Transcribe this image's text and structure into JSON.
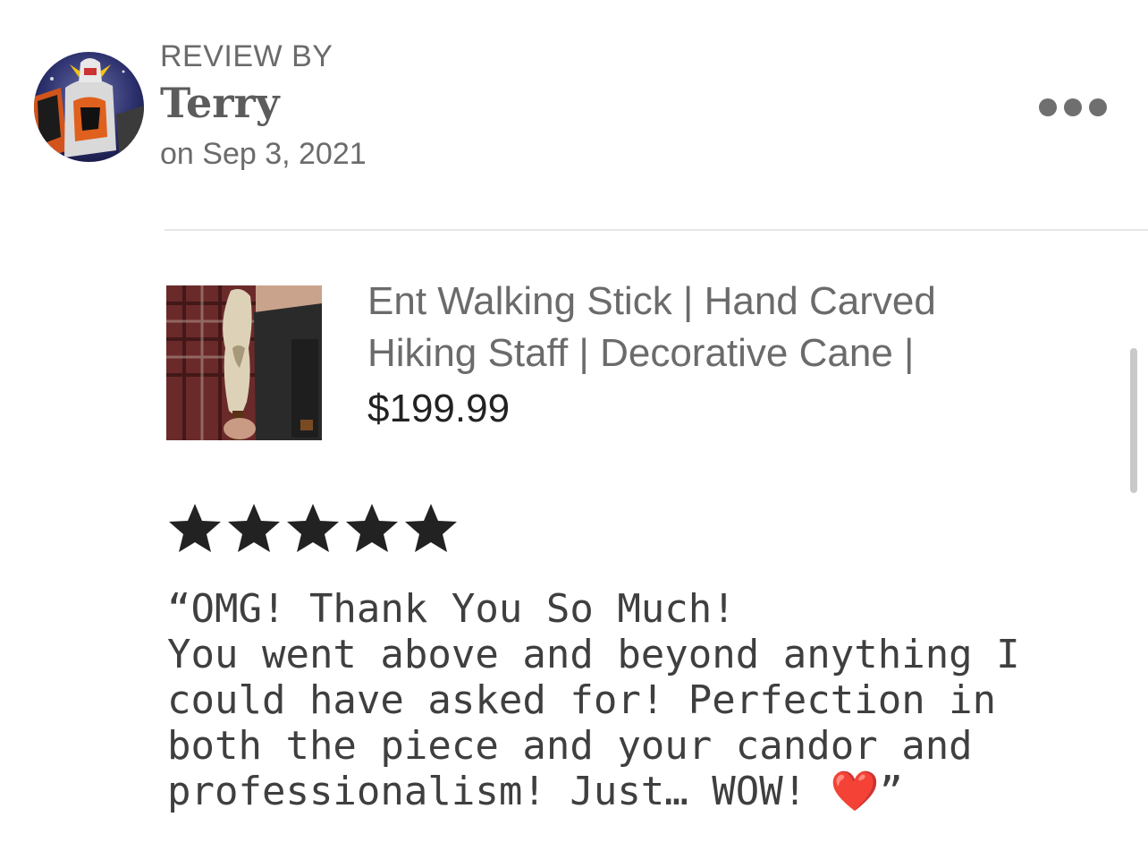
{
  "header": {
    "review_by_label": "REVIEW BY",
    "reviewer_name": "Terry",
    "review_date": "on Sep 3, 2021",
    "more_icon": "more-horizontal-icon"
  },
  "product": {
    "title": "Ent Walking Stick | Hand Carved Hiking Staff | Decorative Cane |",
    "price": "$199.99"
  },
  "rating": {
    "stars": 5,
    "max_stars": 5,
    "icon": "star-icon",
    "color": "#222222"
  },
  "review": {
    "text_before_heart": "“OMG! Thank You So Much!\nYou went above and beyond anything I could have asked for! Perfection in both the piece and your candor and professionalism! Just… WOW! ",
    "heart_emoji": "❤️",
    "text_after_heart": "”"
  },
  "colors": {
    "heart": "#c4161c",
    "muted_text": "#6b6b6b",
    "price_text": "#222222"
  }
}
